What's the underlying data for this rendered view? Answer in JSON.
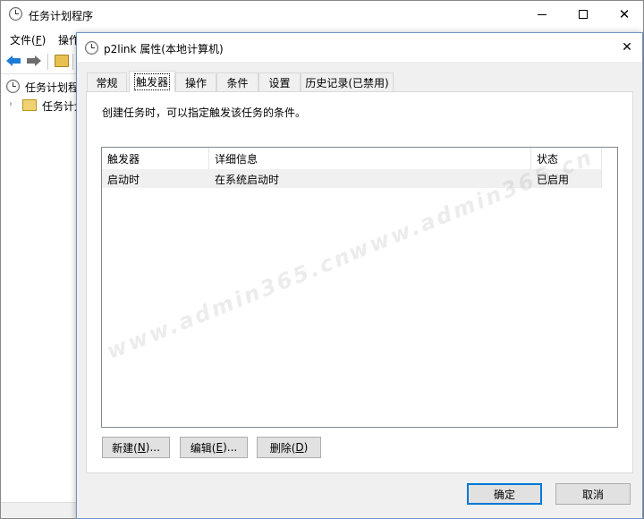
{
  "main_window": {
    "title": "任务计划程序",
    "menu": [
      {
        "pre": "文件(",
        "key": "F",
        "post": ")"
      },
      {
        "pre": "操作",
        "key": "",
        "post": ""
      }
    ],
    "tree": {
      "root_label": "任务计划程",
      "child_label": "任务计划"
    },
    "controls": {
      "minimize": "—",
      "maximize": "☐",
      "close": "✕"
    }
  },
  "dialog": {
    "title": "p2link 属性(本地计算机)",
    "close_symbol": "✕",
    "tabs": [
      {
        "label": "常规",
        "active": false
      },
      {
        "label": "触发器",
        "active": true
      },
      {
        "label": "操作",
        "active": false
      },
      {
        "label": "条件",
        "active": false
      },
      {
        "label": "设置",
        "active": false
      },
      {
        "label": "历史记录(已禁用)",
        "active": false
      }
    ],
    "description": "创建任务时，可以指定触发该任务的条件。",
    "list": {
      "columns": [
        "触发器",
        "详细信息",
        "状态"
      ],
      "rows": [
        {
          "trigger": "启动时",
          "details": "在系统启动时",
          "status": "已启用"
        }
      ]
    },
    "buttons": {
      "new": {
        "pre": "新建(",
        "key": "N",
        "post": ")..."
      },
      "edit": {
        "pre": "编辑(",
        "key": "E",
        "post": ")..."
      },
      "delete": {
        "pre": "删除(",
        "key": "D",
        "post": ")"
      },
      "ok": "确定",
      "cancel": "取消"
    }
  },
  "watermark": "www.admin365.cn",
  "colors": {
    "accent": "#0078d7",
    "dialog_border": "#6f93c4",
    "row_bg": "#f0f0f0",
    "back_arrow": "#1e7bd6",
    "forward_arrow": "#6d6d6d"
  }
}
